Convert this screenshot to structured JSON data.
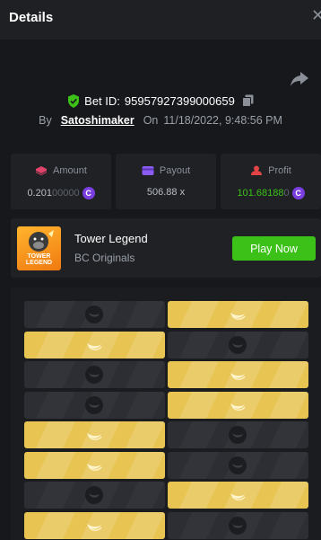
{
  "header": {
    "title": "Details",
    "close_icon": "close-icon"
  },
  "bet": {
    "label": "Bet ID:",
    "id": "95957927399000659"
  },
  "byline": {
    "by": "By",
    "user": "Satoshimaker",
    "on": "On",
    "date": "11/18/2022, 9:48:56 PM"
  },
  "stats": {
    "amount": {
      "label": "Amount",
      "value": "0.201",
      "value_dim": "00000",
      "icon": "amount-icon"
    },
    "payout": {
      "label": "Payout",
      "value": "506.88 x",
      "icon": "payout-icon"
    },
    "profit": {
      "label": "Profit",
      "value": "101.68188",
      "value_dim": "0",
      "icon": "profit-icon"
    }
  },
  "game": {
    "thumb_text_line1": "TOWER",
    "thumb_text_line2": "LEGEND",
    "name": "Tower Legend",
    "provider": "BC Originals",
    "play_label": "Play Now"
  },
  "coin_symbol": "C",
  "colors": {
    "accent_green": "#3bc117",
    "gold_tile": "#e8c452",
    "dark_tile": "#2c2e33",
    "coin": "#7a3ee0"
  },
  "board": {
    "rows": [
      [
        "dark",
        "gold"
      ],
      [
        "gold",
        "dark"
      ],
      [
        "dark",
        "gold"
      ],
      [
        "dark",
        "gold"
      ],
      [
        "gold",
        "dark"
      ],
      [
        "gold",
        "dark"
      ],
      [
        "dark",
        "gold"
      ],
      [
        "gold",
        "dark"
      ]
    ]
  }
}
